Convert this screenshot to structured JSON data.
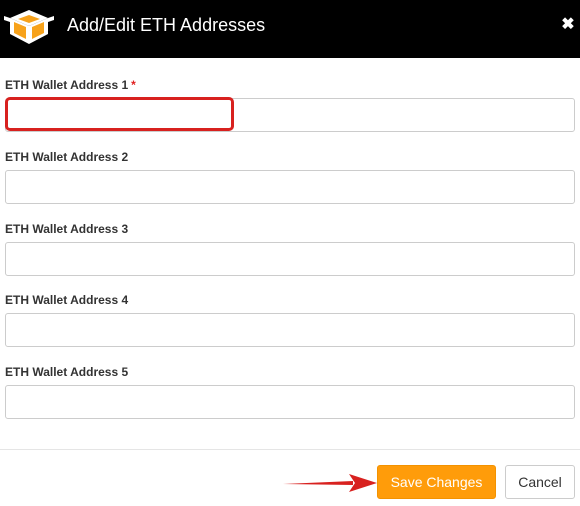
{
  "header": {
    "title": "Add/Edit ETH Addresses",
    "logo_icon": "box-logo-icon",
    "close_icon": "close-icon",
    "close_glyph": "✖"
  },
  "form": {
    "fields": [
      {
        "label": "ETH Wallet Address 1",
        "required_mark": "*",
        "value": ""
      },
      {
        "label": "ETH Wallet Address 2",
        "value": ""
      },
      {
        "label": "ETH Wallet Address 3",
        "value": ""
      },
      {
        "label": "ETH Wallet Address 4",
        "value": ""
      },
      {
        "label": "ETH Wallet Address 5",
        "value": ""
      }
    ]
  },
  "footer": {
    "save_label": "Save Changes",
    "cancel_label": "Cancel"
  },
  "colors": {
    "header_bg": "#000000",
    "accent_orange": "#ff9c0a",
    "highlight_red": "#d8211f",
    "required_red": "#e02020"
  }
}
